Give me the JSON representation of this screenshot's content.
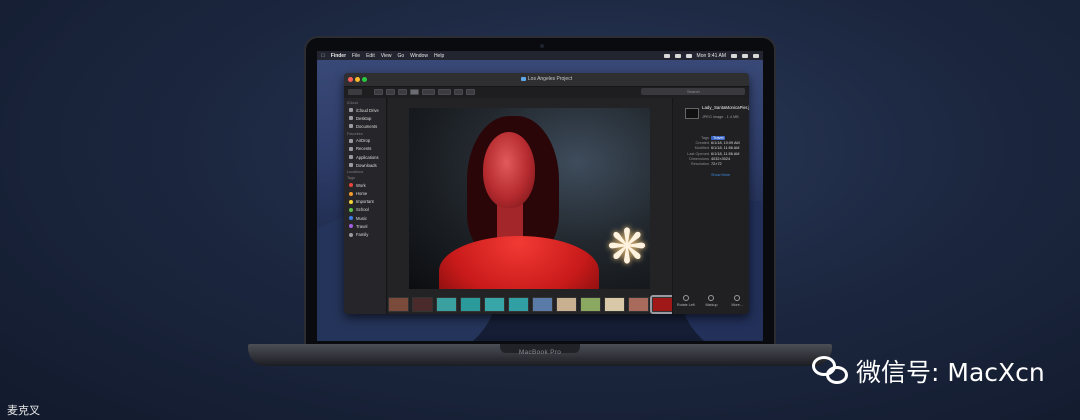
{
  "menubar": {
    "apple_icon": "apple-logo-icon",
    "items": [
      "Finder",
      "File",
      "Edit",
      "View",
      "Go",
      "Window",
      "Help"
    ],
    "clock": "Mon 9:41 AM"
  },
  "finder": {
    "window_title": "Los Angeles Project",
    "search_placeholder": "Search",
    "sidebar": {
      "sections": [
        {
          "title": "iCloud",
          "items": [
            {
              "label": "iCloud Drive",
              "icon": "cloud-icon"
            },
            {
              "label": "Desktop",
              "icon": "desktop-icon"
            },
            {
              "label": "Documents",
              "icon": "document-icon"
            }
          ]
        },
        {
          "title": "Favorites",
          "items": [
            {
              "label": "AirDrop",
              "icon": "airdrop-icon"
            },
            {
              "label": "Recents",
              "icon": "clock-icon"
            },
            {
              "label": "Applications",
              "icon": "applications-icon"
            },
            {
              "label": "Downloads",
              "icon": "download-icon"
            }
          ]
        },
        {
          "title": "Locations",
          "items": []
        },
        {
          "title": "Tags",
          "items": [
            {
              "label": "Work",
              "color": "#e5453a"
            },
            {
              "label": "Home",
              "color": "#f29a2e"
            },
            {
              "label": "Important",
              "color": "#f2d33a"
            },
            {
              "label": "School",
              "color": "#5cc34a"
            },
            {
              "label": "Music",
              "color": "#3a7fe5"
            },
            {
              "label": "Travel",
              "color": "#a35ee0"
            },
            {
              "label": "Family",
              "color": "#9a9aa0"
            }
          ]
        }
      ]
    },
    "inspector": {
      "file_name": "Lady_SantaMonicaPier.jpeg",
      "file_kind": "JPEG image - 1.4 MB",
      "metadata": [
        {
          "label": "Tags",
          "value": "Travel"
        },
        {
          "label": "Created",
          "value": "6/1/18, 10:09 AM"
        },
        {
          "label": "Modified",
          "value": "6/1/18, 11:56 AM"
        },
        {
          "label": "Last Opened",
          "value": "6/1/18, 11:56 AM"
        },
        {
          "label": "Dimensions",
          "value": "4032×3024"
        },
        {
          "label": "Resolution",
          "value": "72×72"
        }
      ],
      "show_more": "Show More",
      "actions": [
        {
          "label": "Rotate Left",
          "icon": "rotate-left-icon"
        },
        {
          "label": "Markup",
          "icon": "markup-icon"
        },
        {
          "label": "More...",
          "icon": "more-icon"
        }
      ]
    },
    "thumbnails": [
      "#7a4a3a",
      "#4a2a2a",
      "#3aa0a0",
      "#2a9a9a",
      "#38a6a8",
      "#30a0a4",
      "#5a7aa8",
      "#c8b090",
      "#8aa860",
      "#d8c8a8",
      "#a86a5a",
      "#a01818"
    ]
  },
  "laptop": {
    "model": "MacBook Pro"
  },
  "watermark": {
    "text": "微信号: MacXcn",
    "icon": "wechat-icon"
  },
  "credit": "麦克叉"
}
